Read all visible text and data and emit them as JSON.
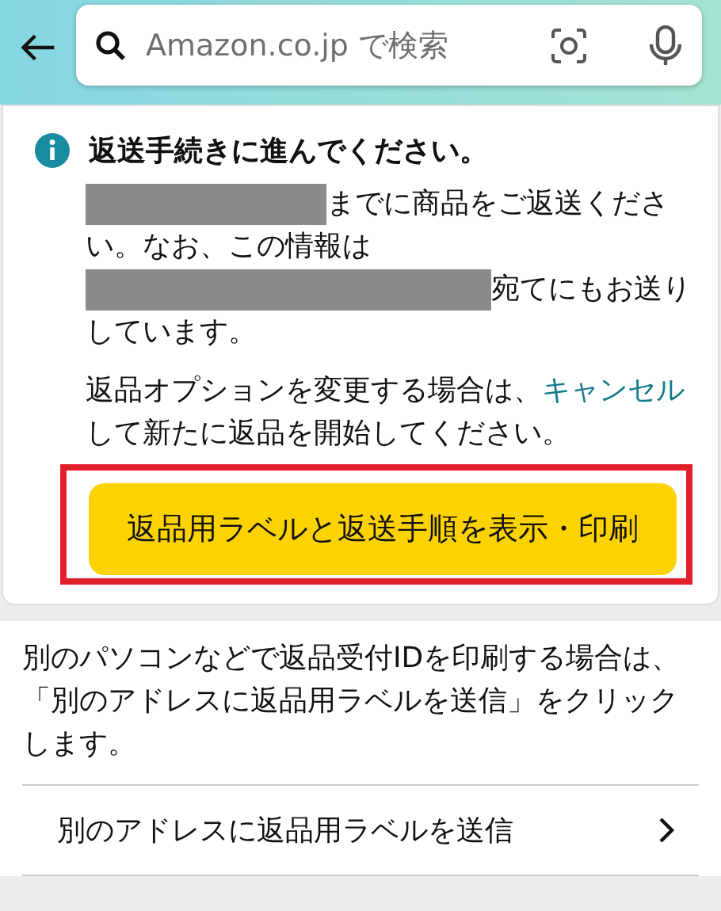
{
  "header": {
    "search": {
      "placeholder": "Amazon.co.jp で検索"
    }
  },
  "notice": {
    "title": "返送手続きに進んでください。",
    "body": [
      {
        "kind": "short-redaction",
        "text": "までに商品をご返送くださ"
      },
      {
        "kind": "plain",
        "text": "い。なお、この情報は"
      },
      {
        "kind": "long-redaction",
        "text": "宛てにもお送り"
      },
      {
        "kind": "plain",
        "text": "しています。"
      }
    ],
    "option_text": {
      "before": "返品オプションを変更する場合は、",
      "link": "キャンセル",
      "after": "して新たに返品を開始してください。"
    },
    "button": {
      "label": "返品用ラベルと返送手順を表示・印刷",
      "highlighted": true
    }
  },
  "help_text": "別のパソコンなどで返品受付IDを印刷する場合は、「別のアドレスに返品用ラベルを送信」をクリックします。",
  "links": [
    {
      "label": "別のアドレスに返品用ラベルを送信"
    }
  ]
}
